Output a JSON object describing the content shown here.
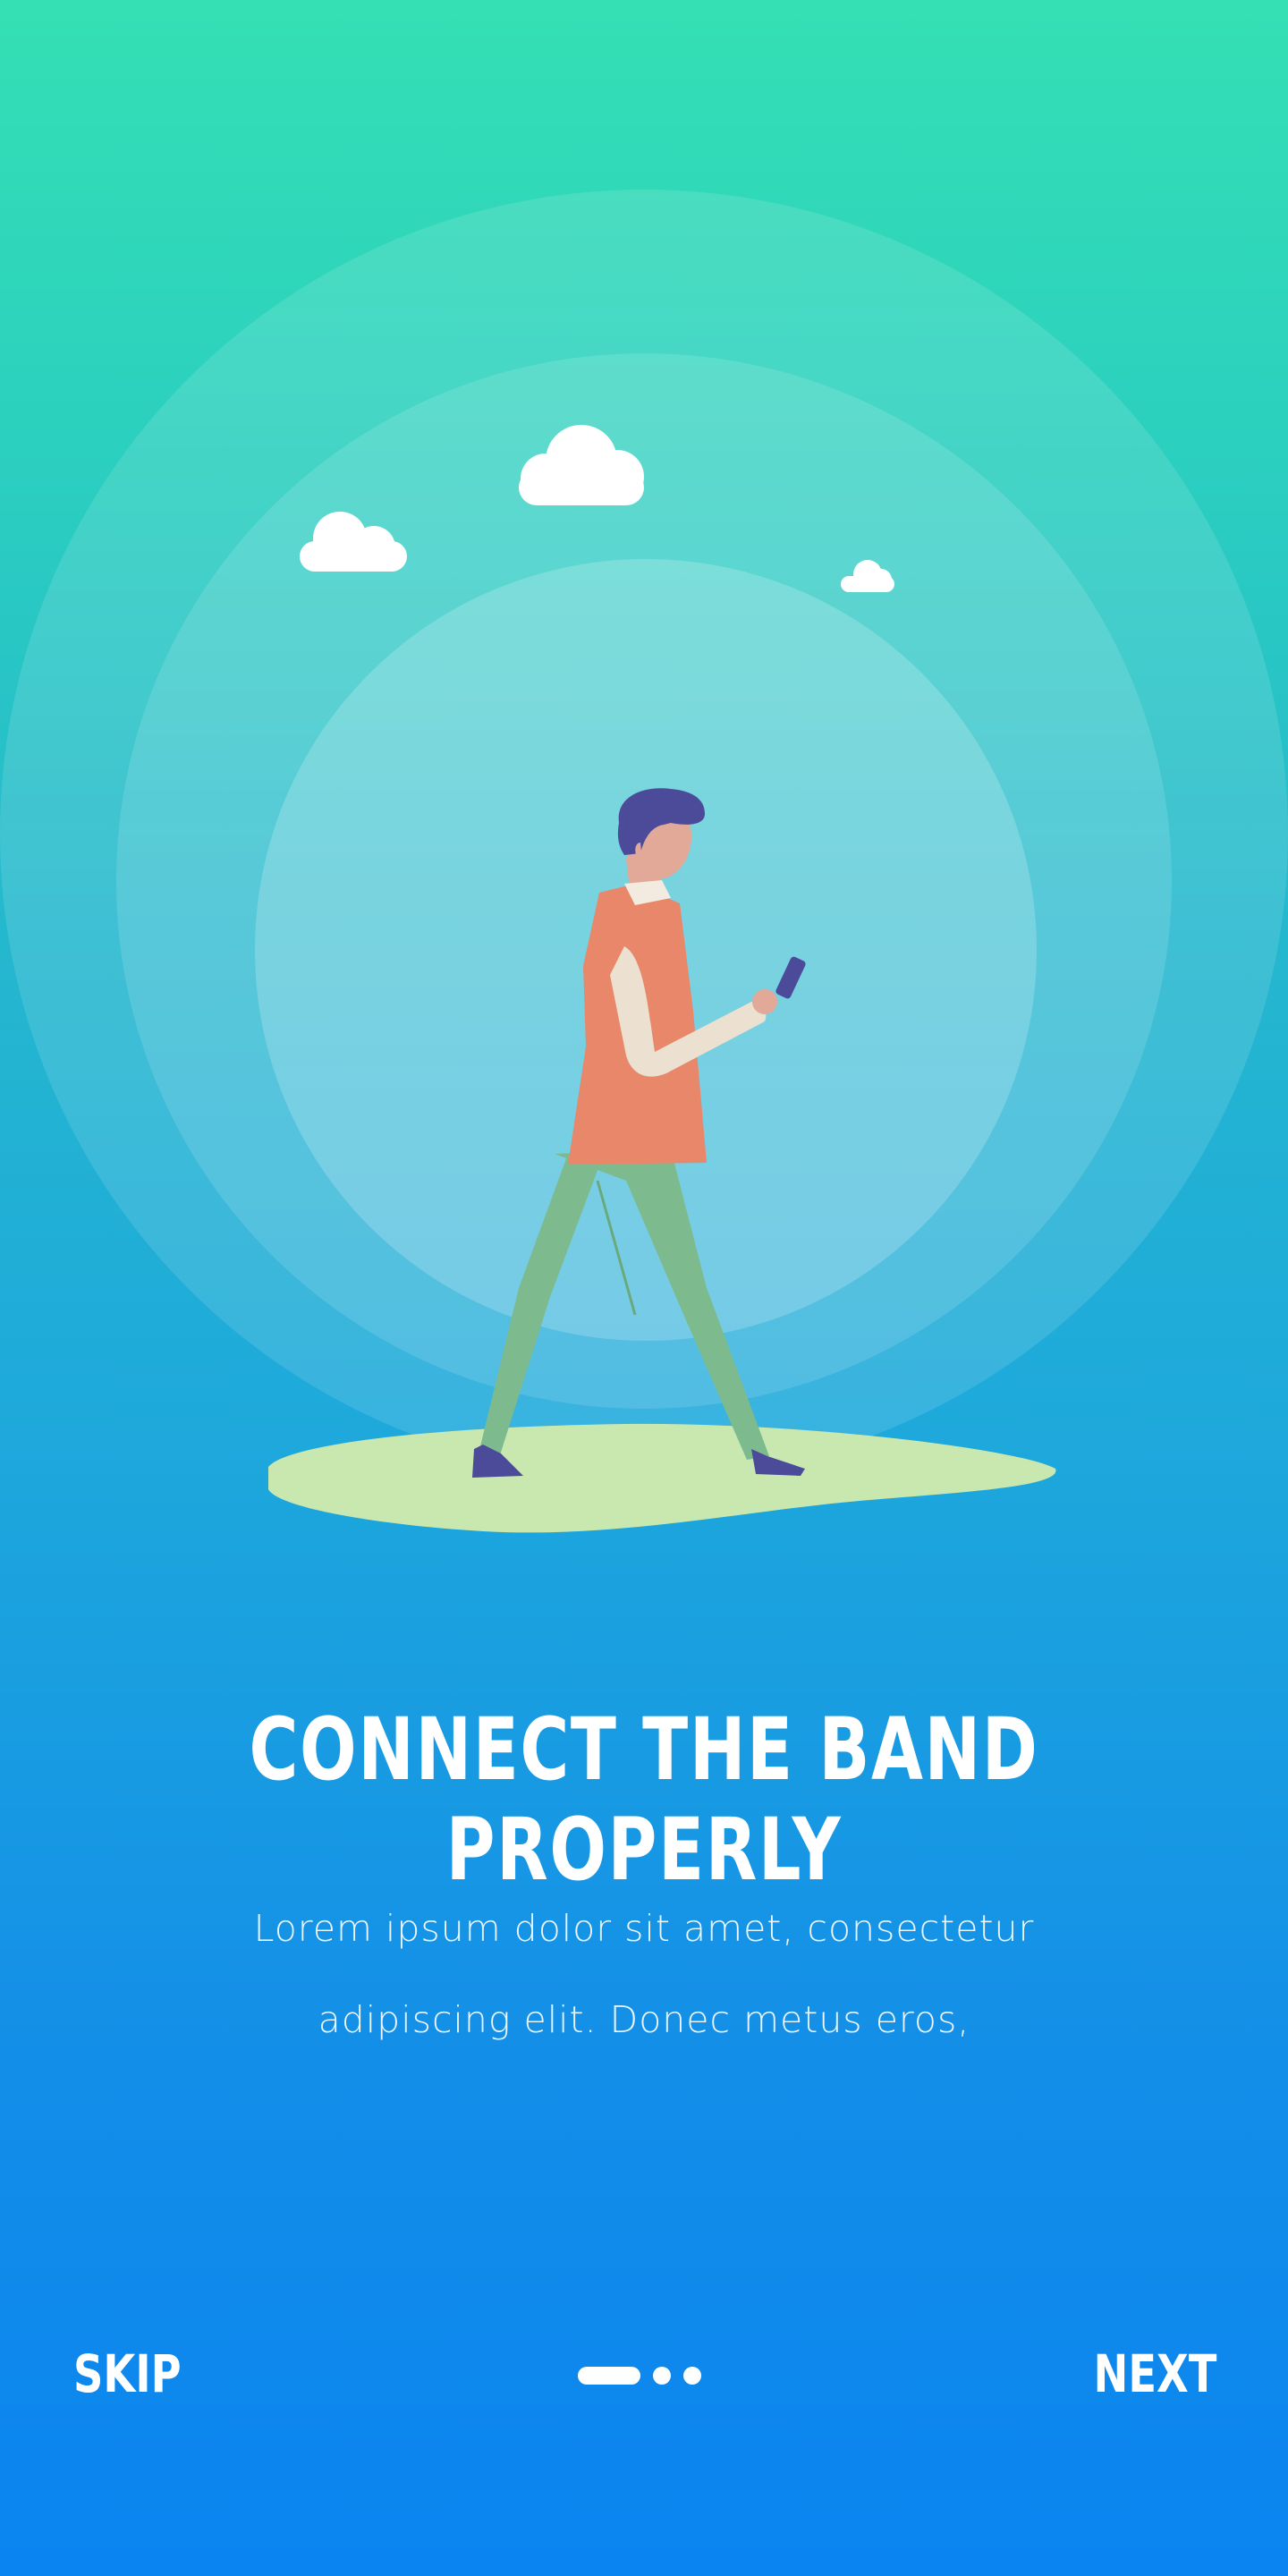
{
  "onboarding": {
    "title": "CONNECT THE BAND PROPERLY",
    "body_line1": "Lorem ipsum dolor sit amet, consectetur",
    "body_line2": "adipiscing elit. Donec metus eros,"
  },
  "footer": {
    "skip_label": "SKIP",
    "next_label": "NEXT",
    "pagination": {
      "current": 1,
      "total": 3
    }
  },
  "colors": {
    "gradient_top": "#34e0b4",
    "gradient_bottom": "#0a84f0",
    "ground": "#c8e8b0",
    "shirt": "#e8876a",
    "pants": "#7dbb8f",
    "hair": "#4b4b9a",
    "skin": "#e2a898",
    "sleeve": "#ece0d0"
  }
}
